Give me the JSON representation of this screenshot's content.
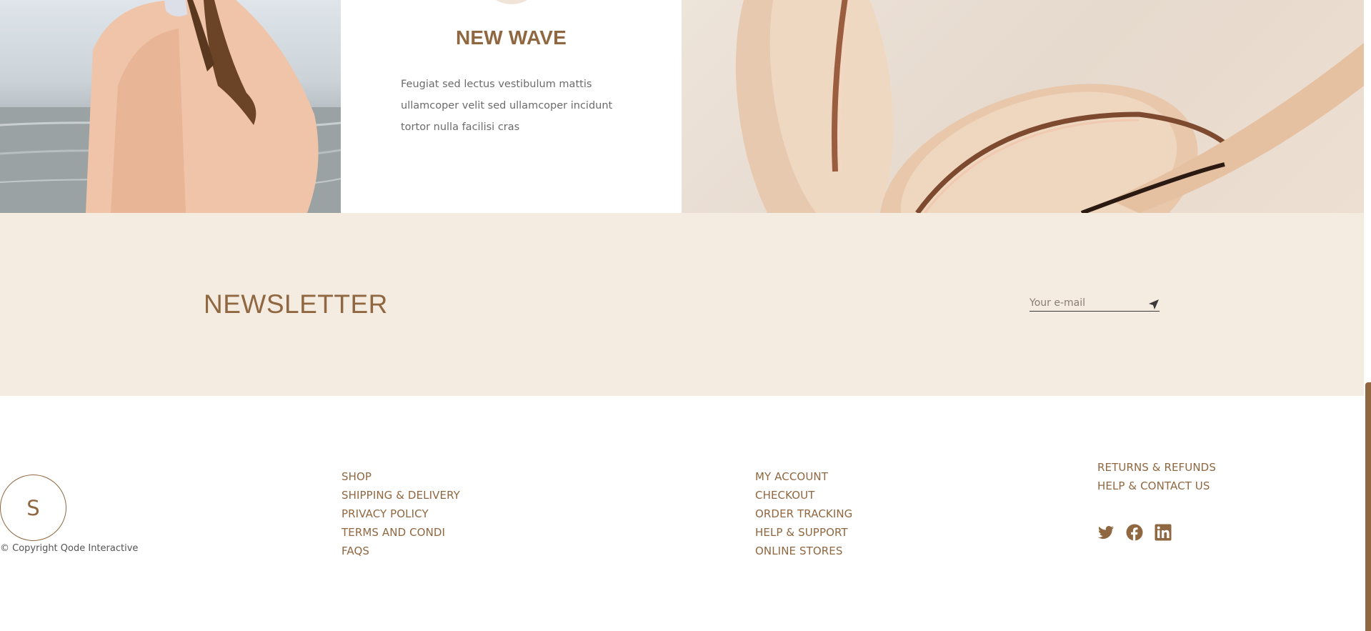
{
  "card": {
    "title": "NEW WAVE",
    "text": "Feugiat sed lectus vestibulum mattis ullamcoper velit sed ullamcoper incidunt tortor nulla facilisi cras"
  },
  "newsletter": {
    "title": "NEWSLETTER",
    "placeholder": "Your e-mail"
  },
  "footer": {
    "logo_letter": "S",
    "copyright": "© Copyright Qode Interactive",
    "col1": [
      "SHOP",
      "SHIPPING & DELIVERY",
      "PRIVACY POLICY",
      "TERMS AND CONDI",
      "FAQS"
    ],
    "col2": [
      "MY ACCOUNT",
      "CHECKOUT",
      "ORDER TRACKING",
      "HELP & SUPPORT",
      "ONLINE STORES"
    ],
    "col3": [
      "RETURNS & REFUNDS",
      "HELP & CONTACT US"
    ],
    "social": [
      "twitter-icon",
      "facebook-icon",
      "linkedin-icon"
    ]
  },
  "colors": {
    "accent": "#8f6740",
    "newsletter_bg": "#f4ebe1"
  }
}
